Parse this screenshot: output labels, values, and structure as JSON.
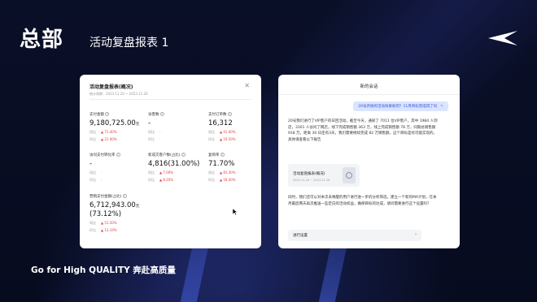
{
  "header": {
    "title": "总部",
    "subtitle": "活动复盘报表 1"
  },
  "footer": {
    "slogan": "Go for High QUALITY 奔赴高质量"
  },
  "colors": {
    "background": "#070b1e",
    "accent_blue": "#3050d0",
    "up_red": "#e04040"
  },
  "report": {
    "title": "活动复盘报表(概况)",
    "date_range": "统计周期：2023.11.20 ~ 2023.11.26",
    "close_icon": "close-icon",
    "metrics": [
      {
        "label": "支付金额",
        "value": "9,180,725.00",
        "unit": "元",
        "rows": [
          {
            "k": "同比",
            "v": "▲ 71.40%"
          },
          {
            "k": "环比",
            "v": "▲ 21.00%"
          }
        ]
      },
      {
        "label": "访客数",
        "value": "-",
        "unit": "",
        "rows": [
          {
            "k": "同比",
            "v": "-"
          },
          {
            "k": "环比",
            "v": "-"
          }
        ]
      },
      {
        "label": "支付订单数",
        "value": "16,312",
        "unit": "",
        "rows": [
          {
            "k": "同比",
            "v": "▲ 41.00%"
          },
          {
            "k": "环比",
            "v": "▲ 19.50%"
          }
        ]
      },
      {
        "label": "访问支付转化率",
        "value": "-",
        "unit": "",
        "rows": [
          {
            "k": "同比",
            "v": "-"
          },
          {
            "k": "环比",
            "v": "-"
          }
        ]
      },
      {
        "label": "新成交客户数(占比)",
        "value": "4,816(31.00%)",
        "unit": "",
        "rows": [
          {
            "k": "同比",
            "v": "▲ 7.00%"
          },
          {
            "k": "环比",
            "v": "▲ 8.20%"
          }
        ]
      },
      {
        "label": "复购率",
        "value": "71.70%",
        "unit": "",
        "rows": [
          {
            "k": "同比",
            "v": "▲ 81.30%"
          },
          {
            "k": "环比",
            "v": "▲ 18.40%"
          }
        ]
      },
      {
        "label": "营销支付金额(占比)",
        "value": "6,712,943.00",
        "unit": "元",
        "value2": "(73.12%)",
        "rows": [
          {
            "k": "同比",
            "v": "▲ 51.20%"
          },
          {
            "k": "环比",
            "v": "▲ 13.19%"
          }
        ]
      }
    ]
  },
  "chat": {
    "title": "新的会话",
    "user_message": "20号开始的活动效果如何？11月目标完成得了吗",
    "edit_icon": "pencil-icon",
    "reply1": "20号我们进行了VIP客户的日回活动，截至今天，通知了 7011 位VIP客户，其中 1984 人到店，3301 人访问了网店，线下完成销售额 363 万，线上完成销售额 78 万，同期总销售额 918 万，距离 30 日还有3天，我们需要继续完成 82 万销售额，这个目标是有可能实现的，具体请查看以下报告",
    "card_title": "活动复盘报表(概况)",
    "card_date": "2023.11.20 ~ 2023.11.26",
    "reply2": "同时，我们还可以对本次未唤醒的用户进行进一步的分析筛选，建立一个新的MA计划，在本月最后两天再次推送一些定向的活动权益，确保目标的达成，请问需要进行这个设置吗？",
    "button_label": "进行设置",
    "button_arrow": "›"
  }
}
